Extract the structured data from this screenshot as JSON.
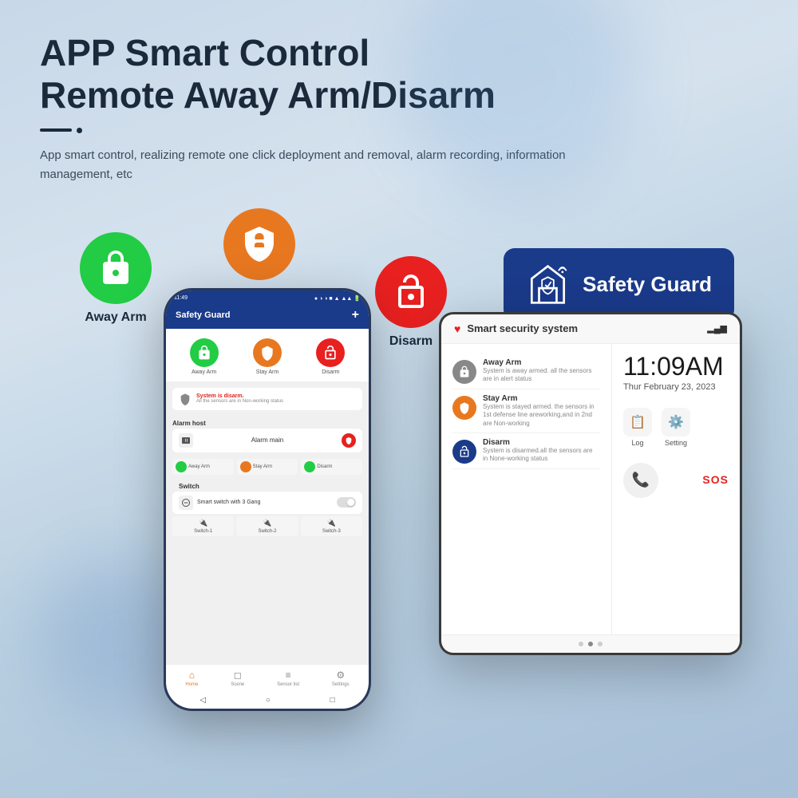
{
  "header": {
    "title_line1": "APP Smart Control",
    "title_line2": "Remote Away Arm/Disarm",
    "subtitle": "App smart control, realizing remote one click deployment and removal, alarm recording, information management, etc"
  },
  "icons": {
    "away_arm_label": "Away Arm",
    "stay_arm_label": "Stay Arm",
    "disarm_label": "Disarm",
    "safety_guard_label": "Safety Guard"
  },
  "phone": {
    "status_bar_time": "11:49",
    "app_title": "Safety Guard",
    "add_button": "+",
    "arm_away_label": "Away Arm",
    "arm_stay_label": "Stay Arm",
    "arm_disarm_label": "Disarm",
    "system_status": "System is disarm.",
    "system_status_sub": "All the sensors are in Non-working status",
    "alarm_host_section": "Alarm host",
    "alarm_main_label": "Alarm main",
    "away_arm_mini": "Away Arm",
    "stay_arm_mini": "Stay Arm",
    "disarm_mini": "Disarm",
    "switch_section": "Switch",
    "switch_label": "Smart switch with 3 Gang",
    "switch1": "Switch-1",
    "switch2": "Switch-2",
    "switch3": "Switch-3",
    "nav_home": "Home",
    "nav_scene": "Scene",
    "nav_sensor": "Sensor list",
    "nav_settings": "Settings"
  },
  "tablet": {
    "app_title": "Smart security system",
    "time": "11:09AM",
    "date": "Thur February 23, 2023",
    "away_arm_title": "Away Arm",
    "away_arm_desc": "System is away armed. all the sensors are in alert status",
    "stay_arm_title": "Stay Arm",
    "stay_arm_desc": "System is stayed armed. the sensors in 1st defense line areworking,and in 2nd are Non-working",
    "disarm_title": "Disarm",
    "disarm_desc": "System is disarmed.all the sensors are in None-working status",
    "log_label": "Log",
    "settings_label": "Setting",
    "sos_label": "SOS"
  },
  "colors": {
    "green": "#22cc44",
    "orange": "#e87820",
    "red": "#e82020",
    "dark_blue": "#1a3a8a",
    "body_bg_start": "#c8d8e8",
    "body_bg_end": "#a8c0d8"
  }
}
